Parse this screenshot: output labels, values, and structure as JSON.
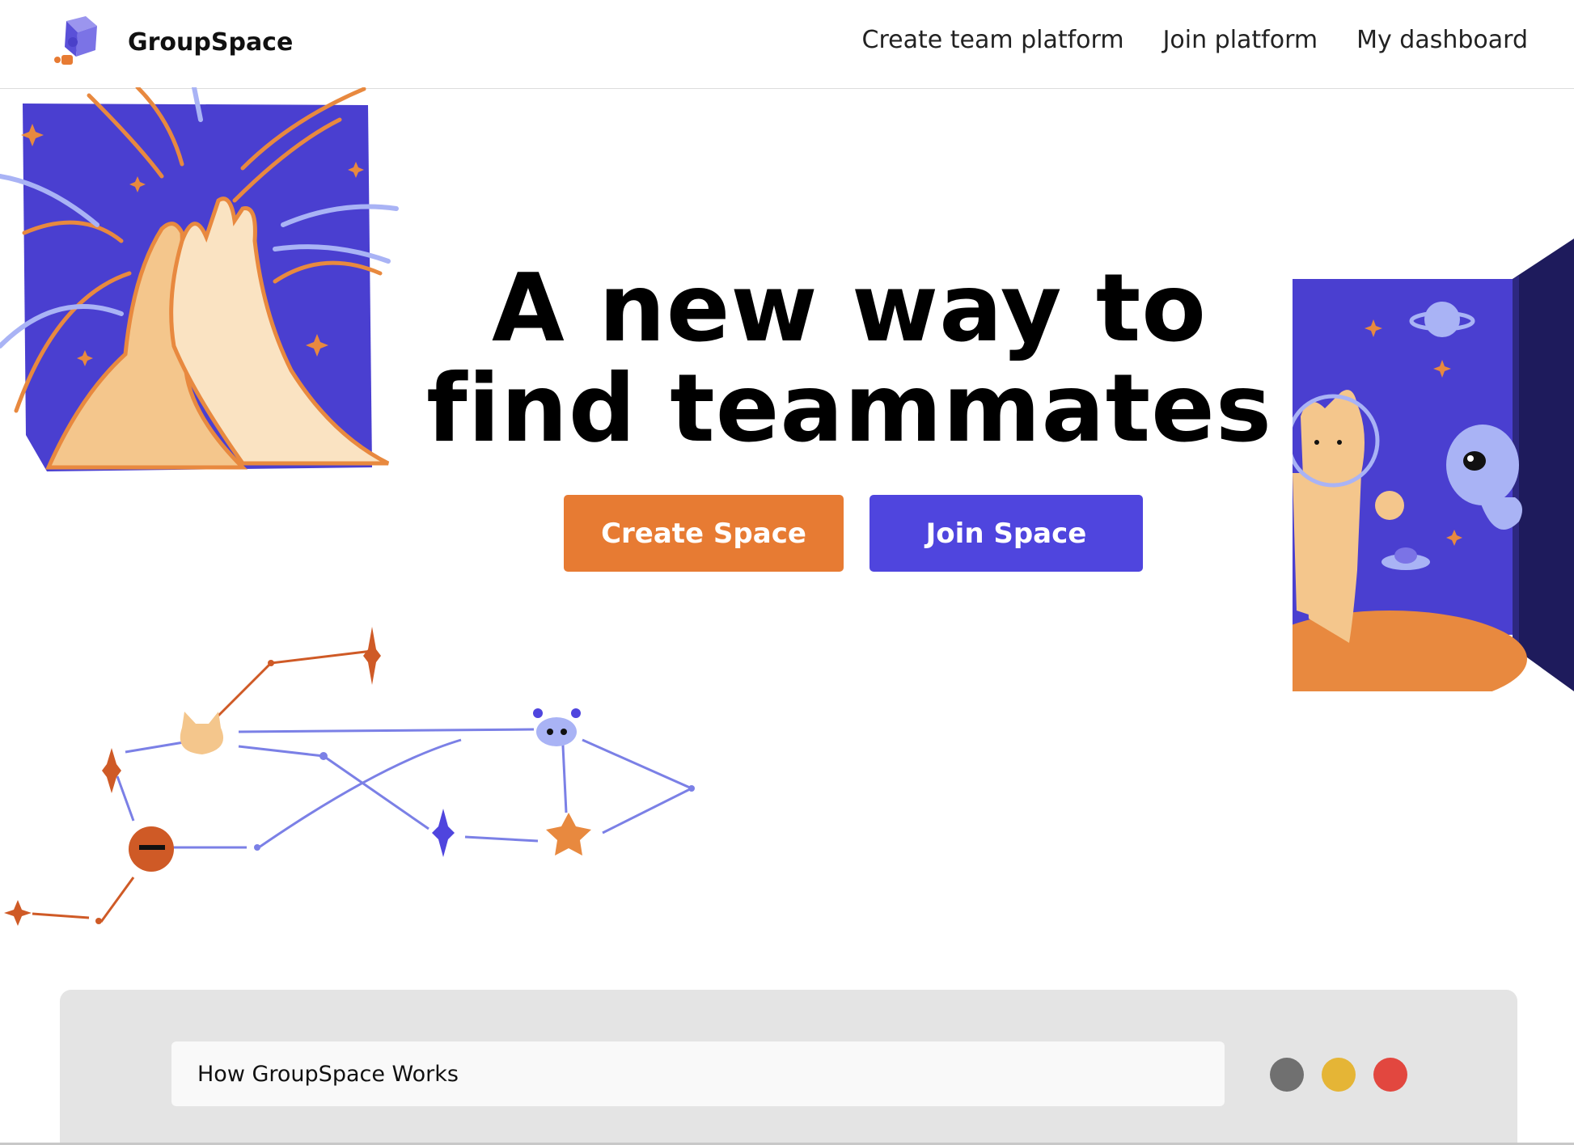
{
  "brand": {
    "name": "GroupSpace",
    "logo_icon": "puzzle-cube-icon"
  },
  "nav": {
    "links": [
      "Create team platform",
      "Join platform",
      "My dashboard"
    ]
  },
  "hero": {
    "title": "A new way to find teammates",
    "create_button": "Create Space",
    "join_button": "Join Space"
  },
  "illustrations": {
    "left": "high-five-illustration",
    "right": "space-cat-alien-illustration",
    "network": "constellation-network-illustration"
  },
  "works_panel": {
    "title": "How GroupSpace Works",
    "dots": [
      "gray",
      "yellow",
      "red"
    ]
  },
  "colors": {
    "accent_orange": "#e77b33",
    "accent_purple": "#4f45de",
    "panel_gray": "#e4e4e4",
    "dot_gray": "#707070",
    "dot_yellow": "#e5b536",
    "dot_red": "#e2473f"
  }
}
